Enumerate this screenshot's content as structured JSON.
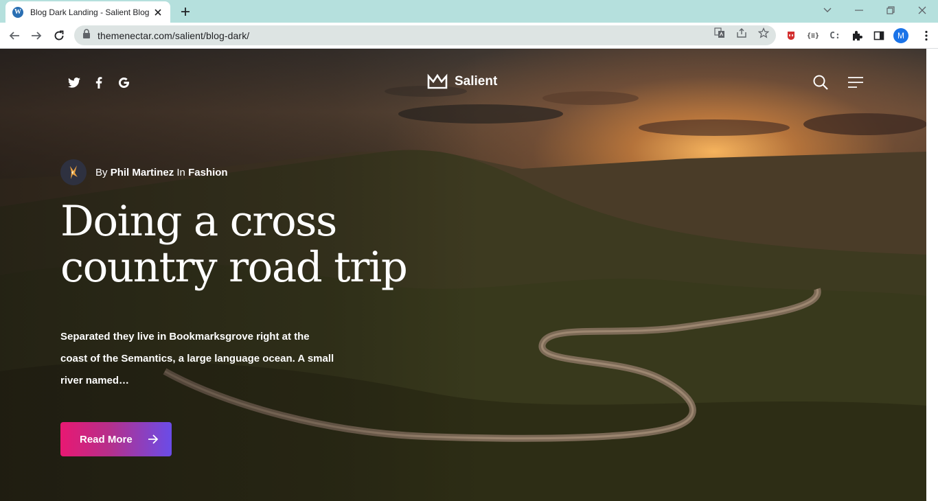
{
  "browser": {
    "tab_title": "Blog Dark Landing - Salient Blog",
    "url": "themenectar.com/salient/blog-dark/",
    "profile_initial": "M",
    "ext_json_label": "{≡}",
    "ext_c_label": "C:"
  },
  "header": {
    "brand": "Salient",
    "social": [
      "twitter-icon",
      "facebook-icon",
      "google-icon"
    ]
  },
  "post": {
    "by_label": "By",
    "author": "Phil Martinez",
    "in_label": "In",
    "category": "Fashion",
    "title_line1": "Doing a cross",
    "title_line2": "country road trip",
    "excerpt": "Separated they live in Bookmarksgrove right at the coast of the Semantics, a large language ocean. A small river named…",
    "cta_label": "Read More"
  },
  "colors": {
    "tabstrip": "#b5e0dd",
    "cta_start": "#e81872",
    "cta_end": "#6a4ce8"
  }
}
